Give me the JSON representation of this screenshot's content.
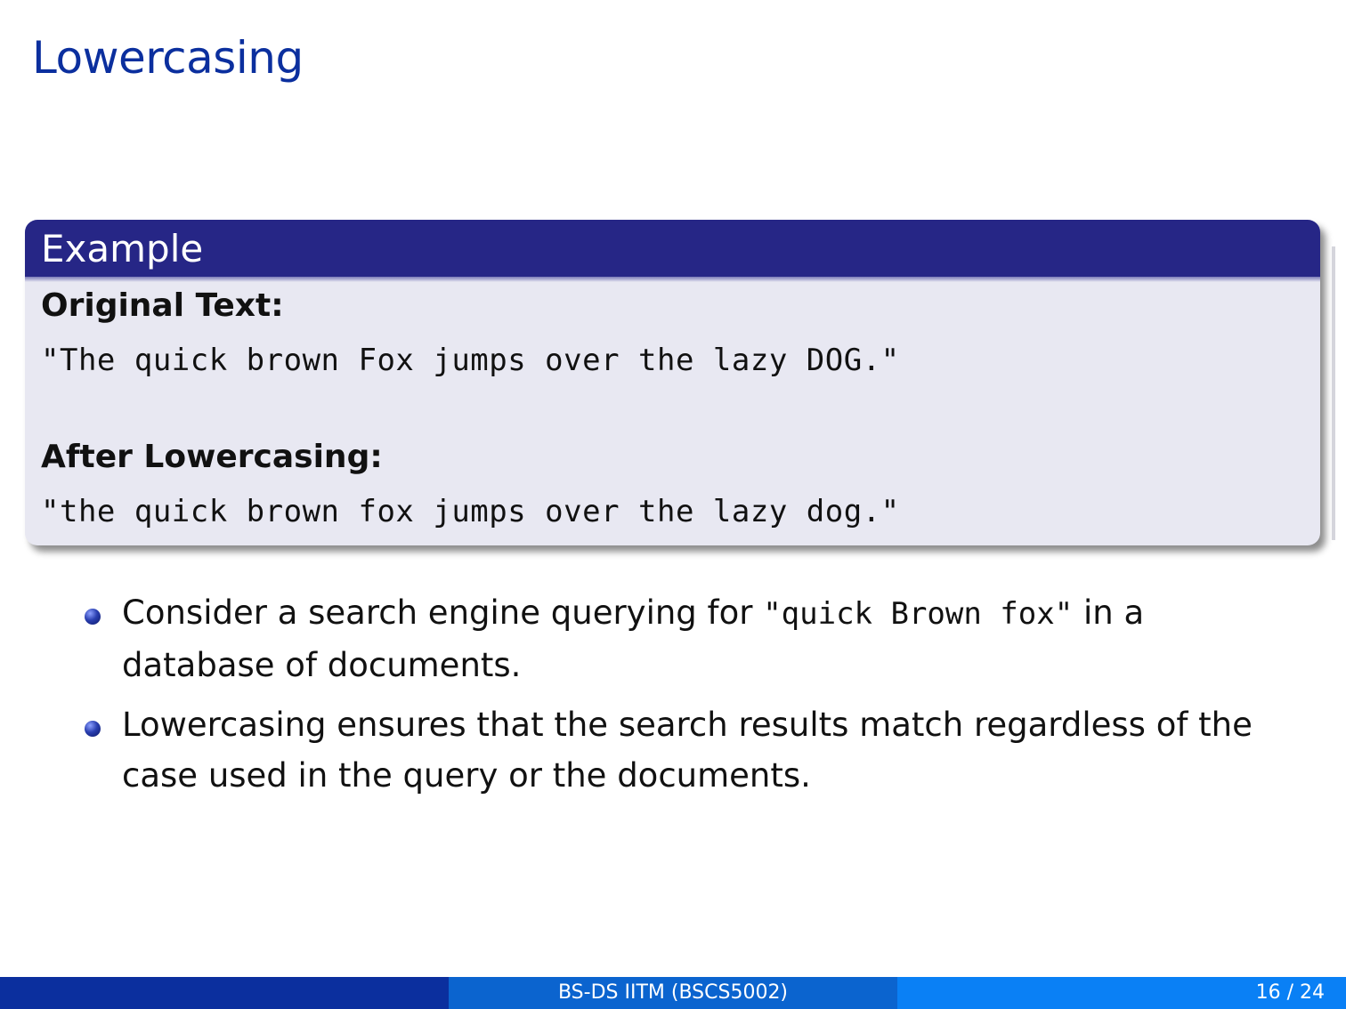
{
  "slide": {
    "title": "Lowercasing"
  },
  "example_block": {
    "heading": "Example",
    "original_label": "Original Text:",
    "original_text": "\"The quick brown Fox jumps over the lazy DOG.\"",
    "after_label": "After Lowercasing:",
    "after_text": "\"the quick brown fox jumps over the lazy dog.\""
  },
  "bullets": [
    {
      "before": "Consider a search engine querying for ",
      "code": "\"quick Brown fox\"",
      "after": " in a database of documents."
    },
    {
      "text": "Lowercasing ensures that the search results match regardless of the case used in the query or the documents."
    }
  ],
  "footer": {
    "center": "BS-DS IITM (BSCS5002)",
    "page": "16 / 24"
  },
  "colors": {
    "title": "#0b2f9e",
    "block_header": "#262686",
    "block_body": "#e8e8f2",
    "footer_left": "#0b2f9e",
    "footer_mid": "#0b64cf",
    "footer_right": "#0a80f5"
  }
}
